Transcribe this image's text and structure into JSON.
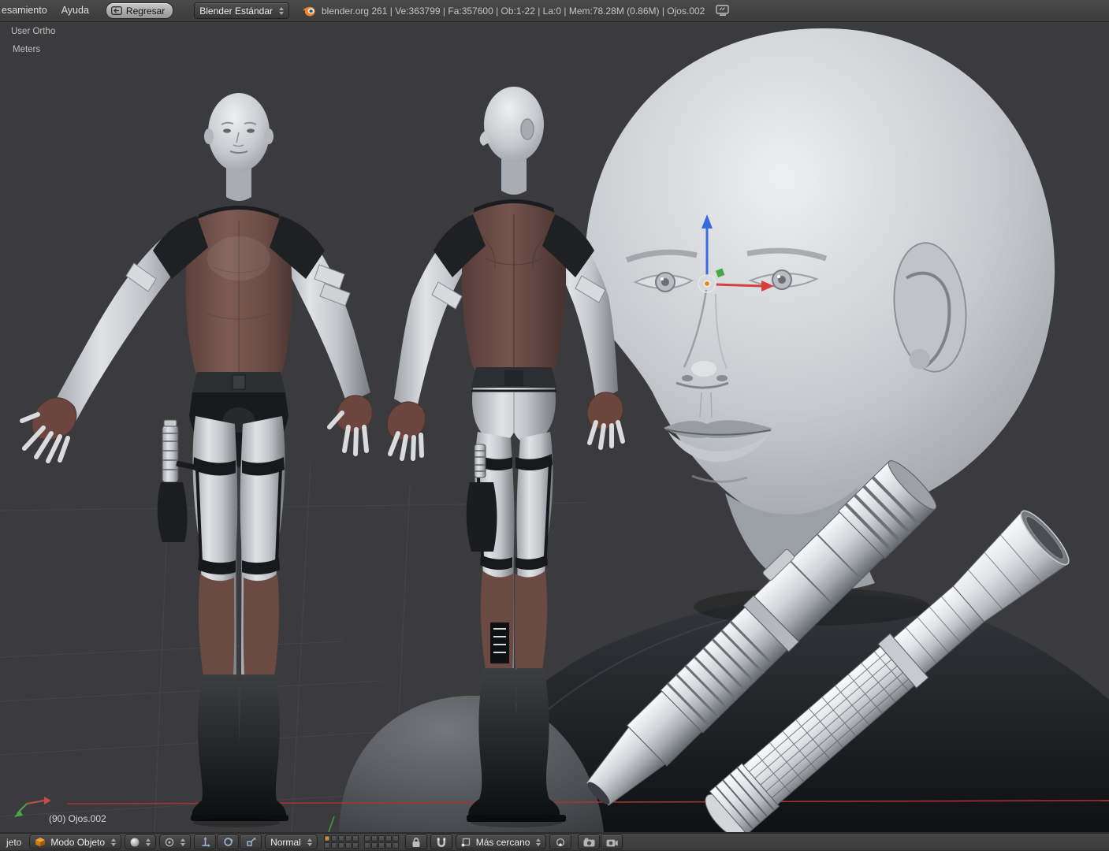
{
  "top_bar": {
    "menu_render_partial": "esamiento",
    "menu_help": "Ayuda",
    "back_button_label": "Regresar",
    "layout_preset": "Blender Estándar",
    "status_text": "blender.org 261 | Ve:363799 | Fa:357600 | Ob:1-22 | La:0 | Mem:78.28M (0.86M) | Ojos.002"
  },
  "viewport": {
    "view_label": "User Ortho",
    "units_label": "Meters",
    "active_object_label": "(90) Ojos.002"
  },
  "bottom_bar": {
    "menu_object_partial": "jeto",
    "mode_select": "Modo Objeto",
    "orientation_select": "Normal",
    "snap_element_select": "Más cercano"
  },
  "icons": {
    "back": "back-arrow-box",
    "dropdown_arrows": "up-down-triangles",
    "blender_logo": "orange-swirl-circle",
    "mode_cube": "orange-cube",
    "shading_sphere": "shaded-sphere",
    "pivot": "pivot-point",
    "manipulator_translate": "axis-arrows",
    "manipulator_rotate": "rotation-ring",
    "manipulator_scale": "scale-box",
    "lock": "padlock",
    "snap": "magnet",
    "snap_element": "vertex-cube",
    "snap_target": "target-dot",
    "render_still": "camera",
    "render_anim": "film-camera",
    "screen": "window-screen"
  },
  "colors": {
    "header_bg": "#404040",
    "viewport_bg": "#3b3b3d",
    "axis_x_red": "#aa3333",
    "accent_orange": "#e0891e",
    "suit_brown": "#6b4a44",
    "manipulator_blue": "#3c6bd9",
    "manipulator_red": "#d84040",
    "manipulator_green": "#45a845"
  }
}
